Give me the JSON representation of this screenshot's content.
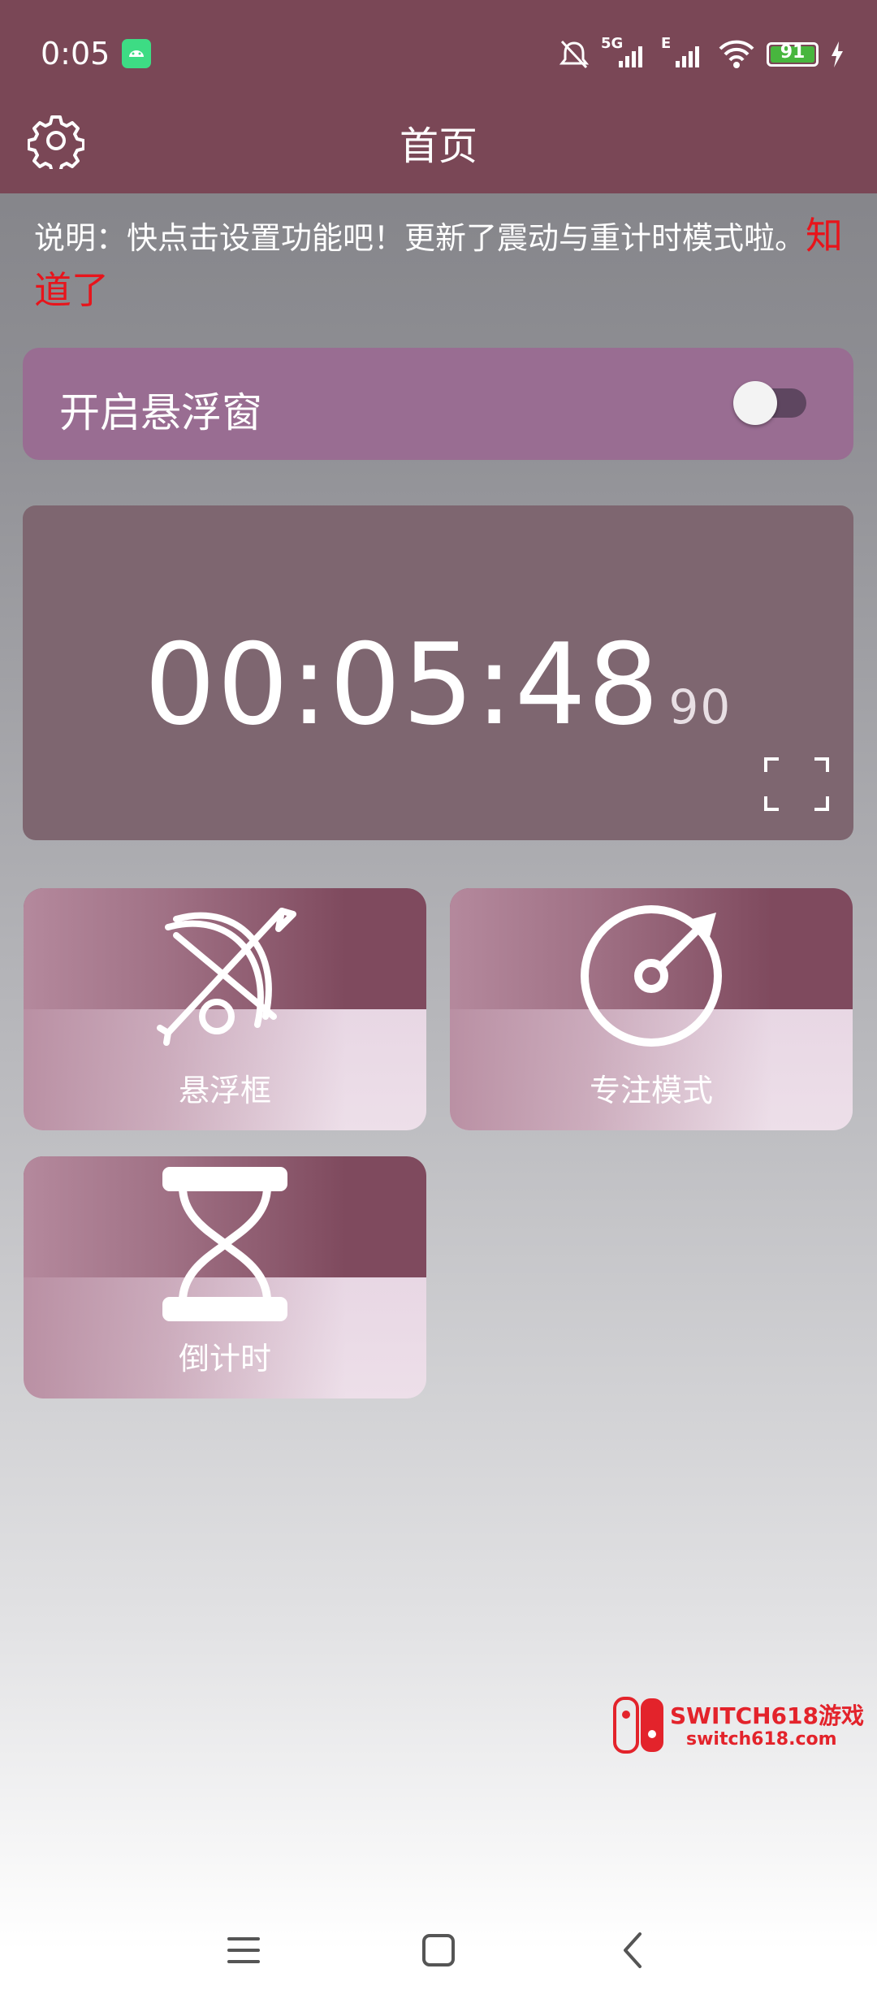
{
  "status_bar": {
    "time": "0:05",
    "network_label": "5G",
    "edge_label": "E",
    "battery": "91"
  },
  "toolbar": {
    "title": "首页"
  },
  "notice": {
    "text": "说明：快点击设置功能吧！更新了震动与重计时模式啦。",
    "link": "知道了"
  },
  "float_window": {
    "label": "开启悬浮窗",
    "enabled": false
  },
  "timer": {
    "main": "00:05:48",
    "fraction": "90"
  },
  "tiles": [
    {
      "label": "悬浮框",
      "icon": "bow-arrow-icon"
    },
    {
      "label": "专注模式",
      "icon": "target-icon"
    },
    {
      "label": "倒计时",
      "icon": "hourglass-icon"
    }
  ],
  "watermark": {
    "line1": "SWITCH618游戏",
    "line2": "switch618.com"
  },
  "colors": {
    "header": "#7a4756",
    "float_card": "#996d92",
    "timer_card": "#7e6670",
    "notice_link": "#e8141b"
  }
}
